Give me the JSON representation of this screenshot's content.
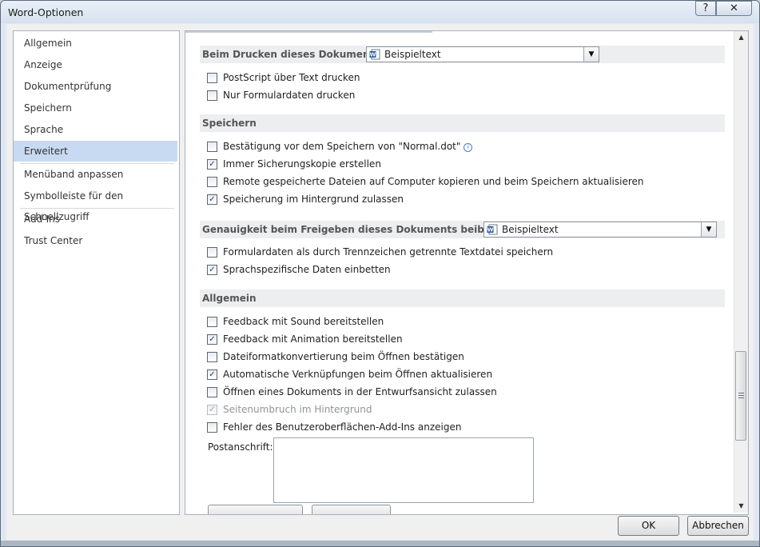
{
  "window": {
    "title": "Word-Optionen",
    "help_label": "?",
    "close_label": "✕"
  },
  "sidebar": {
    "items": [
      {
        "label": "Allgemein"
      },
      {
        "label": "Anzeige"
      },
      {
        "label": "Dokumentprüfung"
      },
      {
        "label": "Speichern"
      },
      {
        "label": "Sprache"
      },
      {
        "label": "Erweitert",
        "selected": true
      },
      {
        "label": "Menüband anpassen"
      },
      {
        "label": "Symbolleiste für den Schnellzugriff"
      },
      {
        "label": "Add-Ins"
      },
      {
        "label": "Trust Center"
      }
    ]
  },
  "print_section": {
    "label": "Beim Drucken dieses Dokuments:",
    "combo_value": "Beispieltext",
    "options": [
      {
        "label": "PostScript über Text drucken",
        "checked": false
      },
      {
        "label": "Nur Formulardaten drucken",
        "checked": false
      }
    ]
  },
  "save_section": {
    "label": "Speichern",
    "options": [
      {
        "label": "Bestätigung vor dem Speichern von \"Normal.dot\"",
        "checked": false
      },
      {
        "label": "Immer Sicherungskopie erstellen",
        "checked": true
      },
      {
        "label": "Remote gespeicherte Dateien auf Computer kopieren und beim Speichern aktualisieren",
        "checked": false
      },
      {
        "label": "Speicherung im Hintergrund zulassen",
        "checked": true
      }
    ]
  },
  "fidelity_section": {
    "label": "Genauigkeit beim Freigeben dieses Dokuments beibehalten:",
    "combo_value": "Beispieltext",
    "options": [
      {
        "label": "Formulardaten als durch Trennzeichen getrennte Textdatei speichern",
        "checked": false
      },
      {
        "label": "Sprachspezifische Daten einbetten",
        "checked": true
      }
    ]
  },
  "general_section": {
    "label": "Allgemein",
    "options": [
      {
        "label": "Feedback mit Sound bereitstellen",
        "checked": false
      },
      {
        "label": "Feedback mit Animation bereitstellen",
        "checked": true
      },
      {
        "label": "Dateiformatkonvertierung beim Öffnen bestätigen",
        "checked": false
      },
      {
        "label": "Automatische Verknüpfungen beim Öffnen aktualisieren",
        "checked": true
      },
      {
        "label": "Öffnen eines Dokuments in der Entwurfsansicht zulassen",
        "checked": false
      },
      {
        "label": "Seitenumbruch im Hintergrund",
        "checked": true,
        "disabled": true
      },
      {
        "label": "Fehler des Benutzeroberflächen-Add-Ins anzeigen",
        "checked": false
      }
    ],
    "address_label": "Postanschrift:",
    "address_value": ""
  },
  "scrollbar": {
    "position_fraction": 0.84
  },
  "footer": {
    "ok_label": "OK",
    "cancel_label": "Abbrechen"
  },
  "icons": {
    "word_doc": "word-document-icon",
    "info": "info-icon",
    "checkmark": "✓"
  }
}
